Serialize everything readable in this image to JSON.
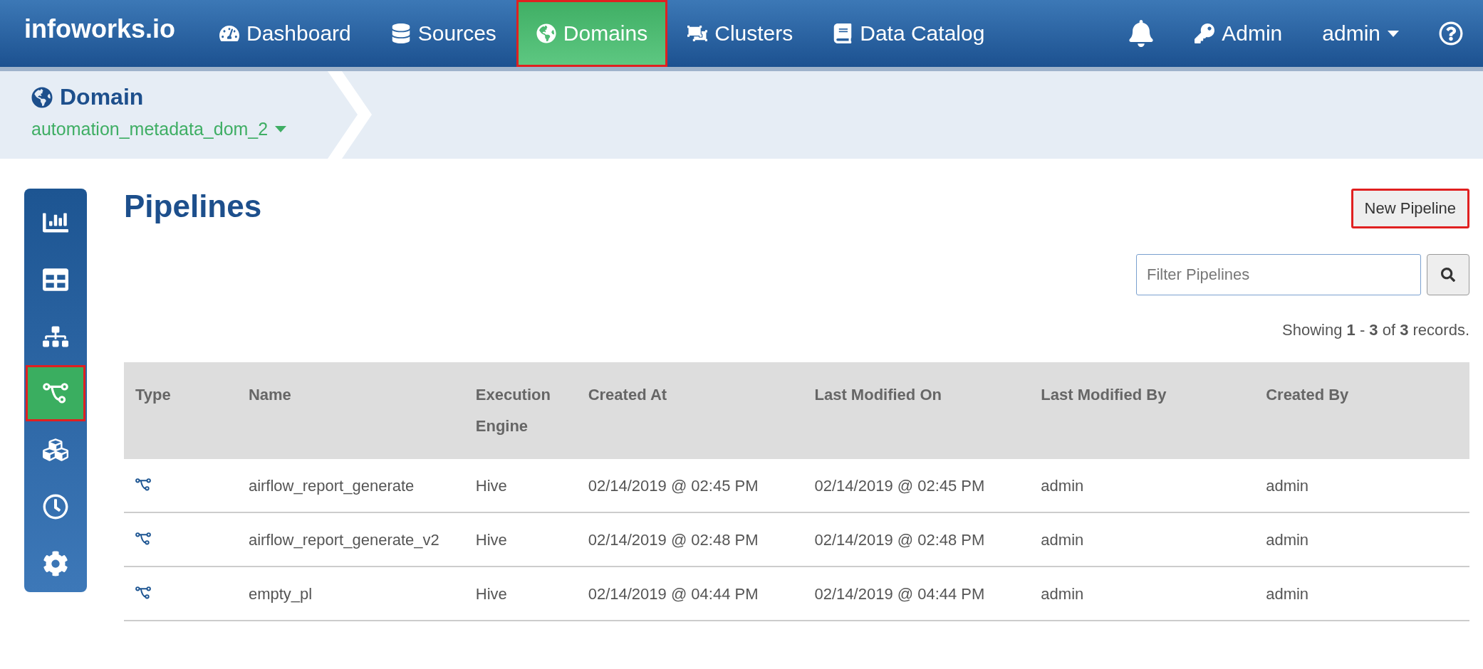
{
  "brand": "infoworks.io",
  "nav": [
    {
      "label": "Dashboard",
      "selected": false,
      "highlighted": false
    },
    {
      "label": "Sources",
      "selected": false,
      "highlighted": false
    },
    {
      "label": "Domains",
      "selected": true,
      "highlighted": true
    },
    {
      "label": "Clusters",
      "selected": false,
      "highlighted": false
    },
    {
      "label": "Data Catalog",
      "selected": false,
      "highlighted": false
    }
  ],
  "nav_right": {
    "admin_link": "Admin",
    "user_menu": "admin"
  },
  "breadcrumb": {
    "title": "Domain",
    "domain": "automation_metadata_dom_2"
  },
  "sidebar": {
    "items": [
      {
        "selected": false,
        "highlighted": false
      },
      {
        "selected": false,
        "highlighted": false
      },
      {
        "selected": false,
        "highlighted": false
      },
      {
        "selected": true,
        "highlighted": true
      },
      {
        "selected": false,
        "highlighted": false
      },
      {
        "selected": false,
        "highlighted": false
      },
      {
        "selected": false,
        "highlighted": false
      }
    ]
  },
  "page_title": "Pipelines",
  "new_button": {
    "label": "New Pipeline",
    "highlighted": true
  },
  "filter": {
    "placeholder": "Filter Pipelines"
  },
  "records": "Showing **1** - **3** of **3** records.",
  "table": {
    "columns": [
      "Type",
      "Name",
      "Execution Engine",
      "Created At",
      "Last Modified On",
      "Last Modified By",
      "Created By"
    ],
    "rows": [
      [
        "",
        "airflow_report_generate",
        "Hive",
        "02/14/2019 @ 02:45 PM",
        "02/14/2019 @ 02:45 PM",
        "admin",
        "admin"
      ],
      [
        "",
        "airflow_report_generate_v2",
        "Hive",
        "02/14/2019 @ 02:48 PM",
        "02/14/2019 @ 02:48 PM",
        "admin",
        "admin"
      ],
      [
        "",
        "empty_pl",
        "Hive",
        "02/14/2019 @ 04:44 PM",
        "02/14/2019 @ 04:44 PM",
        "admin",
        "admin"
      ]
    ]
  }
}
